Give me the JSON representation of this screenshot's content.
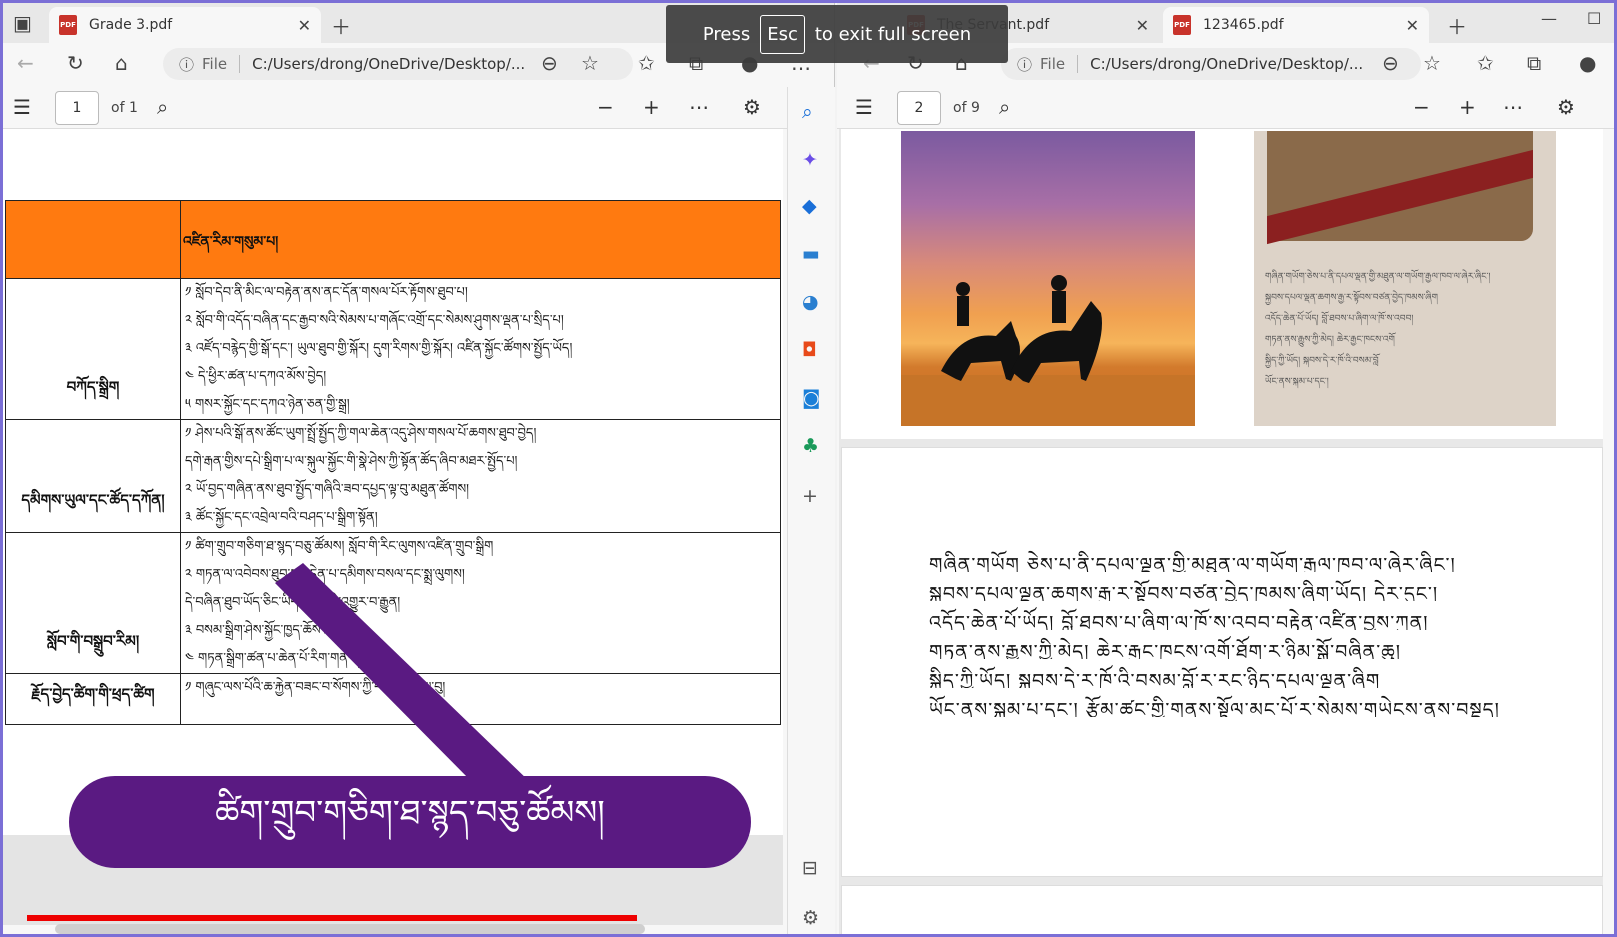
{
  "left_window": {
    "tab_title": "Grade 3.pdf",
    "url_scheme": "File",
    "url": "C:/Users/drong/OneDrive/Desktop/...",
    "page_current": "1",
    "page_total": "of 1"
  },
  "right_window": {
    "tab1_title": "The Servant.pdf",
    "tab2_title": "123465.pdf",
    "url_scheme": "File",
    "url": "C:/Users/drong/OneDrive/Desktop/...",
    "page_current": "2",
    "page_total": "of 9"
  },
  "fullscreen_toast": {
    "prefix": "Press",
    "key": "Esc",
    "suffix": "to exit full screen"
  },
  "table": {
    "header": "འཛིན་རིམ་གསུམ་པ།",
    "rows": [
      {
        "label": "བཀོད་སྒྲིག",
        "lines": [
          "༡ སློབ་དེབ་ནི་མིང་ལ་བརྟེན་ནས་ནང་དོན་གསལ་པོར་རྟོགས་ཐུབ་པ།",
          "༢ སློབ་གི་འདོད་བཞིན་དང་རྒྱབ་སའི་སེམས་པ་གཞོང་འགྲོ་དང་སེམས་ཤུགས་ལྡན་པ་སྲིད་པ།",
          "༣ འཛོད་བརྙེད་གྱི་སྒོ་དང་། ཡུལ་ཐུབ་གྱི་སྐོར། དུག་རིགས་གྱི་སྐོར། འཛིན་སྐྱོང་ཚོགས་སྤྱོད་ཡོད།",
          "༤ དེ་ཕྱིར་ཚན་པ་དཀའ་མོས་བྱེད།",
          "༥ གསར་སྐྱོང་དང་དཀའ་ཉེན་ཅན་གྱི་སྒྲ།"
        ]
      },
      {
        "label": "དམིགས་ཡུལ་དང་ཚོད་དཀོན།",
        "lines": [
          "༡ ཤེས་པའི་སྒོ་ནས་ཚོང་ཡུག་སྤྲོ་སྤྱོད་ཀྱི་གལ་ཆེན་འདུ་ཤེས་གསལ་པོ་ཆགས་ཐུབ་བྱེད།",
          "དགེ་རྒན་གྱིས་དཔེ་སྒྲིག་པ་ལ་སྐུལ་སྐྱོང་གི་སྣེ་ཤེས་ཀྱི་སྟོན་ཚོད་ཞིབ་མཐར་སྤྱོད་པ།",
          "༢ ཡོ་བྱད་གཞིན་ནས་ཐུབ་སྤྱོད་གཞིའི་ཟབ་དཔྱད་ལྟ་བུ་མཐུན་ཚོགས།",
          "༣ ཚོང་སྐྱོང་དང་འབྲེལ་བའི་བཤད་པ་སྒྲིག་སྟོན།"
        ]
      },
      {
        "label": "སློབ་གི་བསྒྲུབ་རིམ།",
        "lines": [
          "༡ ཚིག་གྲུབ་གཅིག་ཐ་སྙད་བཅུ་ཚོམས། སློབ་གི་རིང་ལུགས་འཛིན་གྲུབ་སྒྲིག",
          "༢ གཏན་ལ་འབེབས་ཐུབ་པ་བདེན་པ་དམིགས་བསལ་དང་སྨྲ་ལུགས།",
          "དེ་བཞིན་ཐུབ་ཡོད་ཅིང་ཡིད་ཚིམ་པའི་འགྱུར་བ་རྒྱུན།",
          "༣ བསམ་སྒྲིག་ཤེས་སྐྱོང་ཁྱད་ཆོས་ཕྲན།",
          "༤ གཏན་སྒྲིག་ཚན་པ་ཆེན་པོ་རིག་གནས།"
        ]
      },
      {
        "label": "རྗོད་བྱེད་ཚིག་གི་ཕྲད་ཚིག",
        "lines": [
          "༡ གཞུང་ལས་པོའི་ཆ་རྐྱེན་བཟང་བ་སོགས་ཀྱི་བཀའ་སྒྲོམ་ལྟ་བུ།"
        ]
      }
    ]
  },
  "banner_text": "ཚིག་གྲུབ་གཅིག་ཐ་སྙད་བཅུ་ཚོམས།",
  "right_page_text": [
    "གཞིན་གཡོག ཅེས་པ་ནི་དཔལ་ལྡན་གྱི་མཐུན་ལ་གཡོག་རྒྱལ་ཁབ་ལ་ཞེར་ཞིང་།",
    "སྐྱབས་དཔལ་ལྡན་ཆགས་རྒྱ་ར་སྟོབས་བཙན་བྱེད་ཁམས་ཞིག་ཡོད། དེར་དུང་།",
    "འདོད་ཆེན་པོ་ཡོད། བློ་ཐབས་པ་ཞིག་ལ་ཁོ་ས་འབབ་བརྟེན་འཛིན་བྱས་ཀུན།",
    "གཏན་ནས་རྒྱུས་ཀྱི་མེད། ཆེར་རྒྱང་ཁངས་འགོ་ཐོག་ར་ཉིམ་སྒོ་བཞིན་ཆུ།",
    "སྐྱིད་ཀྱི་ཡོད། སྐབས་དེ་ར་ཁོ་འི་བསམ་བློ་ར་རང་ཉིད་དཔལ་ལྡན་ཞིག",
    "ཡོང་ནས་སྐམ་པ་དང་། རྩོམ་ཚང་གྱི་གནས་སྟོལ་མང་པོ་ར་སེམས་གཡེངས་ནས་བསྡད།"
  ],
  "right_page1_lines": [
    "གཞིན་གཡོག་ཅེས་པ་ནི་དཔལ་ལྡན་གྱི་མཐུན་ལ་གཡོག་རྒྱལ་ཁབ་ལ་ཞེར་ཞིང་།",
    "སྐྱབས་དཔལ་ལྡན་ཆགས་རྒྱ་ར་སྟོབས་བཙན་བྱེད་ཁམས་ཞིག",
    "འདོད་ཆེན་པོ་ཡོད། བློ་ཐབས་པ་ཞིག་ལ་ཁོ་ས་འབབ།",
    "གཏན་ནས་རྒྱུས་ཀྱི་མེད། ཆེར་རྒྱང་ཁངས་འགོ",
    "སྐྱིད་ཀྱི་ཡོད། སྐབས་དེ་ར་ཁོ་འི་བསམ་བློ",
    "ཡོང་ནས་སྐམ་པ་དང་།"
  ],
  "colors": {
    "table_header": "#ff7a10",
    "banner": "#5a1a82",
    "progress": "#e00000"
  },
  "video_progress": 0.68
}
